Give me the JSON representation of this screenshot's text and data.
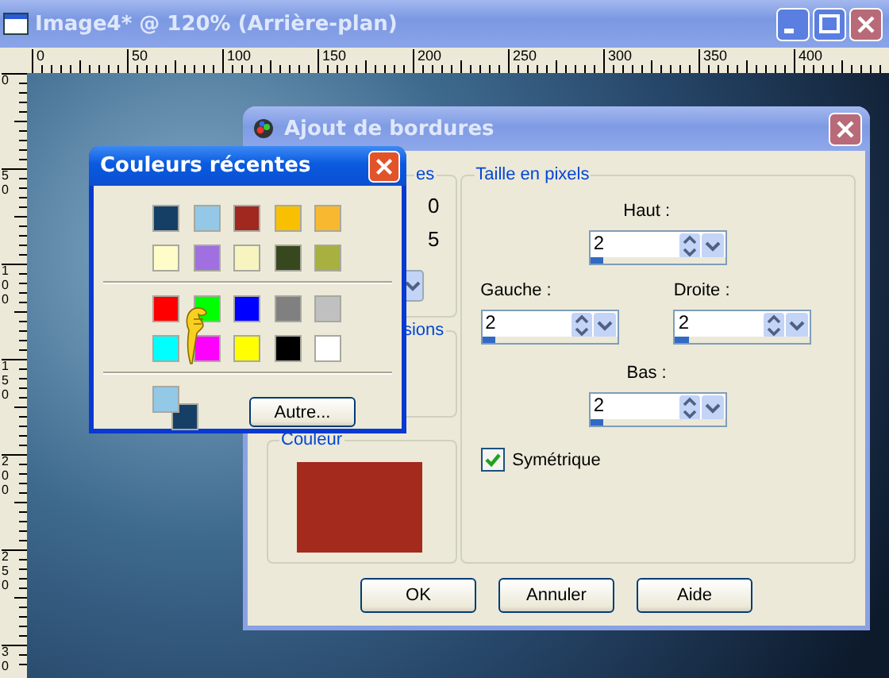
{
  "window": {
    "title": "Image4* @ 120% (Arrière-plan)"
  },
  "rulers": {
    "horizontal": [
      "0",
      "50",
      "100",
      "150",
      "200",
      "250",
      "300",
      "350",
      "400"
    ],
    "vertical": [
      "0",
      "50",
      "100",
      "150",
      "200",
      "250",
      "30"
    ]
  },
  "dialog": {
    "title": "Ajout de bordures",
    "left_groups": [
      {
        "kind": "values",
        "label": "es",
        "values": [
          "0",
          "5"
        ]
      },
      {
        "kind": "empty",
        "label": "sions"
      },
      {
        "kind": "color",
        "label": "Couleur",
        "color": "#a42a1e"
      }
    ],
    "size_group": {
      "label": "Taille en pixels",
      "fields": [
        {
          "label": "Haut :",
          "value": "2",
          "level": 0.1
        },
        {
          "label": "Gauche :",
          "value": "2",
          "level": 0.1
        },
        {
          "label": "Droite :",
          "value": "2",
          "level": 0.1
        },
        {
          "label": "Bas :",
          "value": "2",
          "level": 0.1
        }
      ],
      "symmetric": {
        "label": "Symétrique",
        "checked": true
      }
    },
    "buttons": [
      "OK",
      "Annuler",
      "Aide"
    ]
  },
  "popup": {
    "title": "Couleurs récentes",
    "recent": [
      {
        "color": "#163f66"
      },
      {
        "color": "#93c8e6"
      },
      {
        "color": "#a0281e"
      },
      {
        "color": "#f8c000"
      },
      {
        "color": "#f8b830"
      },
      {
        "color": "#fefcc8"
      },
      {
        "color": "#a070e0"
      },
      {
        "color": "#f8f4c0"
      },
      {
        "color": "#38481e"
      },
      {
        "color": "#a8b040"
      }
    ],
    "standard": [
      {
        "color": "#ff0000"
      },
      {
        "color": "#00ff00"
      },
      {
        "color": "#0000ff"
      },
      {
        "color": "#808080"
      },
      {
        "color": "#c0c0c0"
      },
      {
        "color": "#00ffff"
      },
      {
        "color": "#ff00ff"
      },
      {
        "color": "#ffff00"
      },
      {
        "color": "#000000"
      },
      {
        "color": "#ffffff"
      }
    ],
    "current": [
      {
        "kind": "foreground",
        "color": "#93c8e6"
      },
      {
        "kind": "background",
        "color": "#163f66"
      }
    ],
    "button": "Autre..."
  }
}
